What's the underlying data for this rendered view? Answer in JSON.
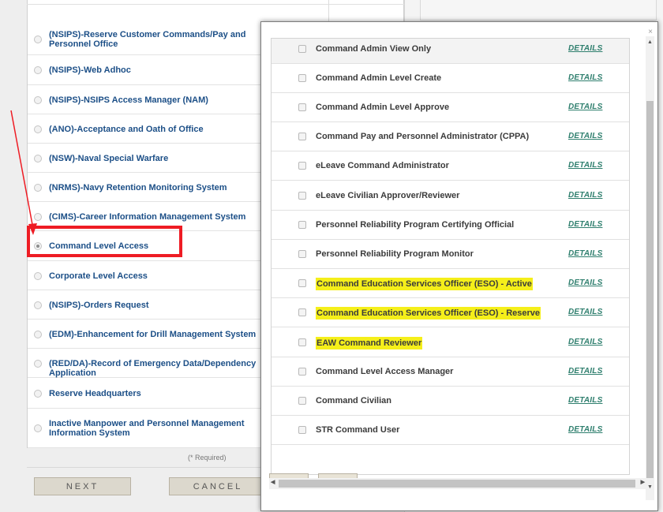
{
  "background": {
    "roles": [
      {
        "label": "(NSIPS)-Reserve Customer Commands/Pay and Personnel Office",
        "checked": false
      },
      {
        "label": "(NSIPS)-Web Adhoc",
        "checked": false
      },
      {
        "label": "(NSIPS)-NSIPS Access Manager (NAM)",
        "checked": false
      },
      {
        "label": "(ANO)-Acceptance and Oath of Office",
        "checked": false
      },
      {
        "label": "(NSW)-Naval Special Warfare",
        "checked": false
      },
      {
        "label": "(NRMS)-Navy Retention Monitoring System",
        "checked": false
      },
      {
        "label": "(CIMS)-Career Information Management System",
        "checked": false
      },
      {
        "label": "Command Level Access",
        "checked": true
      },
      {
        "label": "Corporate Level Access",
        "checked": false
      },
      {
        "label": "(NSIPS)-Orders Request",
        "checked": false
      },
      {
        "label": "(EDM)-Enhancement for Drill Management System",
        "checked": false
      },
      {
        "label": "(RED/DA)-Record of Emergency Data/Dependency Application",
        "checked": false
      },
      {
        "label": "Reserve Headquarters",
        "checked": false
      },
      {
        "label": "Inactive Manpower and Personnel Management Information System",
        "checked": false
      }
    ],
    "required_note": "(* Required)",
    "next_label": "NEXT",
    "cancel_label": "CANCEL"
  },
  "modal": {
    "close_glyph": "×",
    "details_label": "DETAILS",
    "items": [
      {
        "label": "Command Admin View Only",
        "highlighted": false
      },
      {
        "label": "Command Admin Level Create",
        "highlighted": false
      },
      {
        "label": "Command Admin Level Approve",
        "highlighted": false
      },
      {
        "label": "Command Pay and Personnel Administrator (CPPA)",
        "highlighted": false
      },
      {
        "label": "eLeave Command Administrator",
        "highlighted": false
      },
      {
        "label": "eLeave Civilian Approver/Reviewer",
        "highlighted": false
      },
      {
        "label": "Personnel Reliability Program Certifying Official",
        "highlighted": false
      },
      {
        "label": "Personnel Reliability Program Monitor",
        "highlighted": false
      },
      {
        "label": "Command Education Services Officer (ESO) - Active",
        "highlighted": true
      },
      {
        "label": "Command Education Services Officer (ESO) - Reserve",
        "highlighted": true
      },
      {
        "label": "EAW Command Reviewer",
        "highlighted": true
      },
      {
        "label": "Command Level Access Manager",
        "highlighted": false
      },
      {
        "label": "Command Civilian",
        "highlighted": false
      },
      {
        "label": "STR Command User",
        "highlighted": false
      }
    ]
  },
  "colors": {
    "highlight_box": "#ee1c24",
    "text_highlight": "#f5ef1a",
    "role_label": "#1c4f87",
    "details_link": "#2f7f6e"
  }
}
